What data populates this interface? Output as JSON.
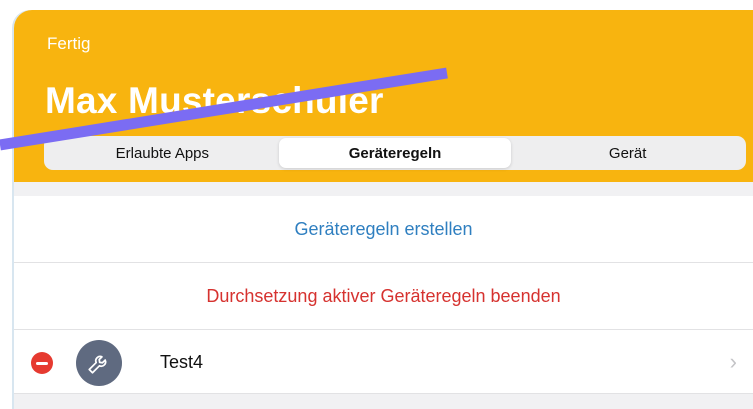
{
  "header": {
    "done_label": "Fertig",
    "title": "Max Musterschuler",
    "tabs": [
      {
        "label": "Erlaubte Apps"
      },
      {
        "label": "Geräteregeln"
      },
      {
        "label": "Gerät"
      }
    ],
    "active_tab": "Geräteregeln"
  },
  "actions": {
    "create_label": "Geräteregeln erstellen",
    "stop_label": "Durchsetzung aktiver Geräteregeln beenden"
  },
  "items": [
    {
      "label": "Test4",
      "icon": "wrench-icon"
    }
  ],
  "colors": {
    "accent": "#f8b40f",
    "link": "#2f7fc0",
    "destructive": "#d6322f",
    "annotation_line": "#7b6cf3"
  }
}
